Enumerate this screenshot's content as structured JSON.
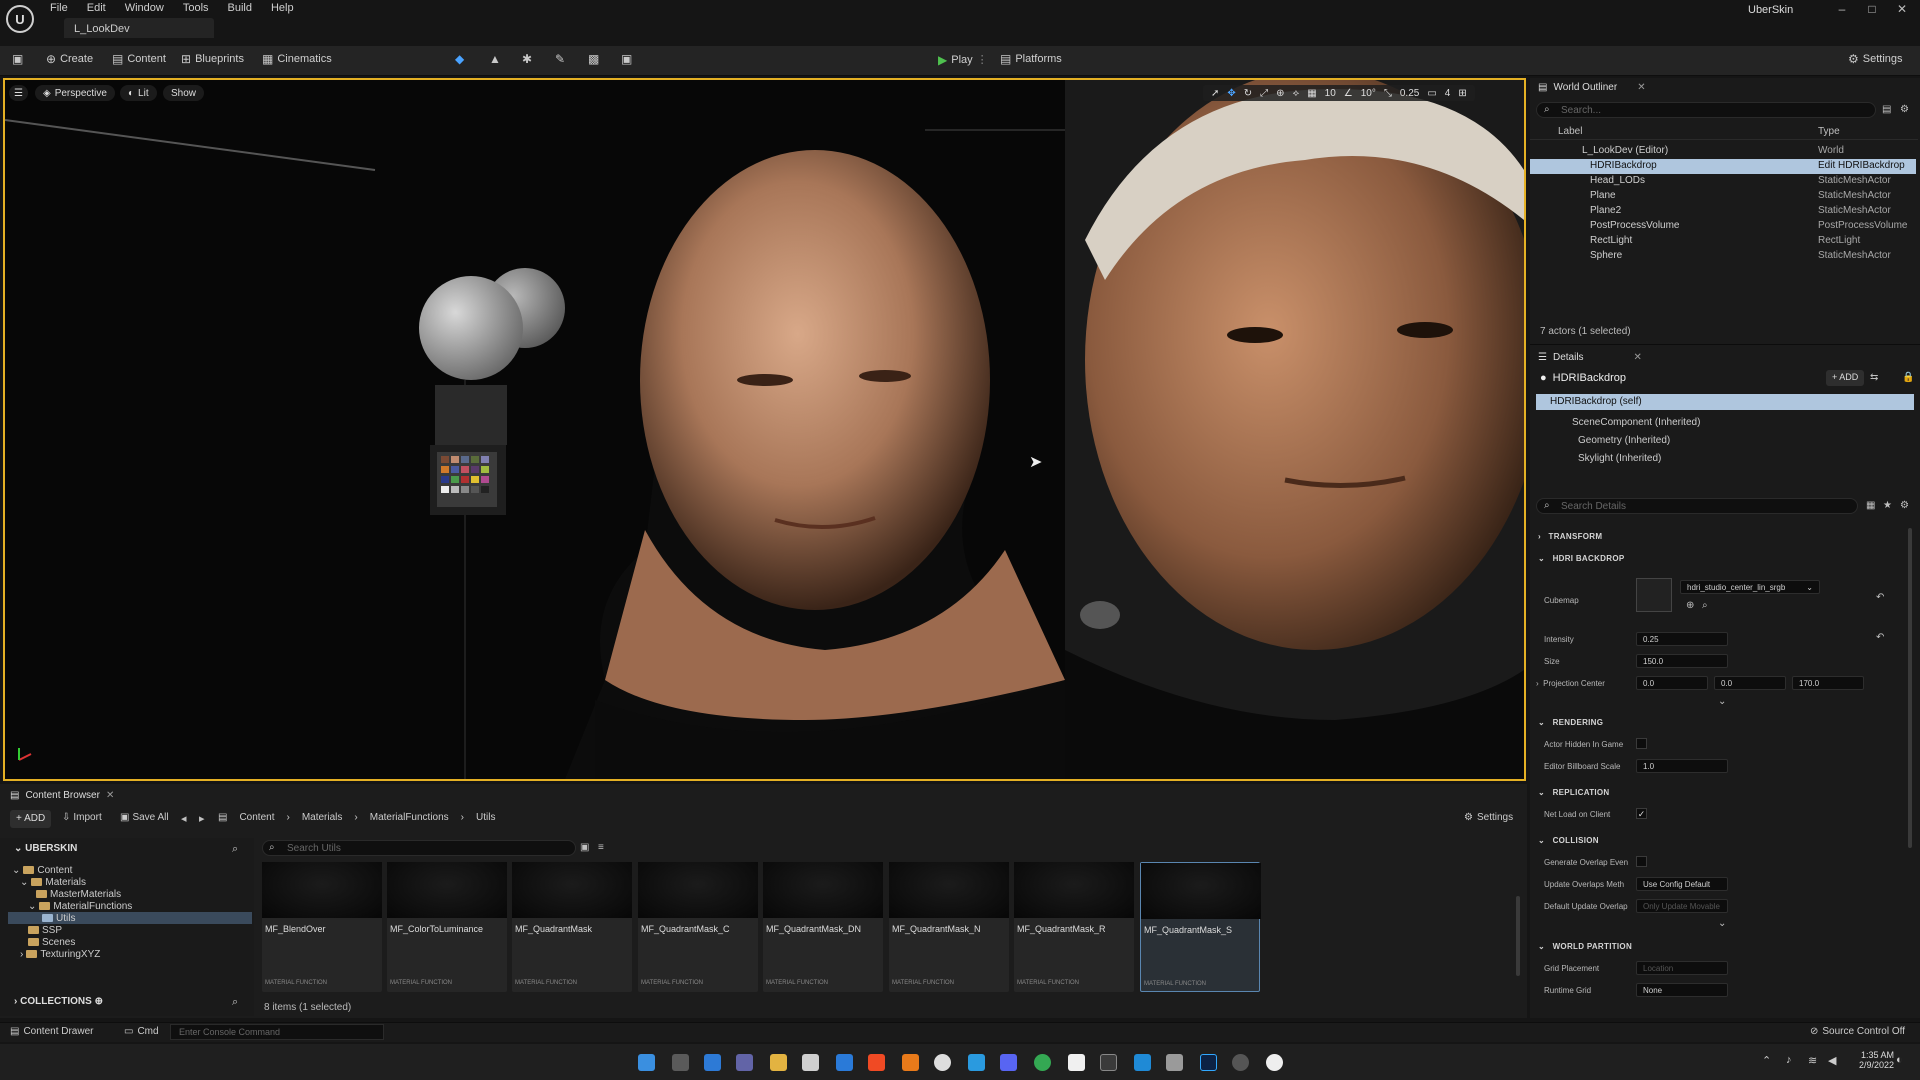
{
  "app": {
    "project": "UberSkin",
    "level_tab": "L_LookDev",
    "menu": [
      "File",
      "Edit",
      "Window",
      "Tools",
      "Build",
      "Help"
    ],
    "win": {
      "min": "–",
      "max": "□",
      "close": "✕"
    }
  },
  "toolbar": {
    "create": "Create",
    "content": "Content",
    "blueprints": "Blueprints",
    "cinematics": "Cinematics",
    "play": "Play",
    "platforms": "Platforms",
    "settings": "Settings"
  },
  "viewport": {
    "perspective": "Perspective",
    "lit": "Lit",
    "show": "Show",
    "grid": "10",
    "angle": "10°",
    "scale": "0.25",
    "camera": "4"
  },
  "outliner": {
    "title": "World Outliner",
    "search": "Search...",
    "col_label": "Label",
    "col_type": "Type",
    "rows": [
      {
        "label": "L_LookDev (Editor)",
        "type": "World"
      },
      {
        "label": "HDRIBackdrop",
        "type": "Edit HDRIBackdrop"
      },
      {
        "label": "Head_LODs",
        "type": "StaticMeshActor"
      },
      {
        "label": "Plane",
        "type": "StaticMeshActor"
      },
      {
        "label": "Plane2",
        "type": "StaticMeshActor"
      },
      {
        "label": "PostProcessVolume",
        "type": "PostProcessVolume"
      },
      {
        "label": "RectLight",
        "type": "RectLight"
      },
      {
        "label": "Sphere",
        "type": "StaticMeshActor"
      }
    ],
    "status": "7 actors (1 selected)"
  },
  "details": {
    "title": "Details",
    "actor": "HDRIBackdrop",
    "add": "ADD",
    "self": "HDRIBackdrop (self)",
    "components": [
      "SceneComponent (Inherited)",
      "Geometry (Inherited)",
      "Skylight (Inherited)"
    ],
    "search": "Search Details",
    "sections": {
      "transform": "TRANSFORM",
      "hdri": "HDRI BACKDROP",
      "rendering": "RENDERING",
      "replication": "REPLICATION",
      "collision": "COLLISION",
      "world_partition": "WORLD PARTITION"
    },
    "cubemap_label": "Cubemap",
    "cubemap_value": "hdri_studio_center_lin_srgb",
    "intensity_label": "Intensity",
    "intensity": "0.25",
    "size_label": "Size",
    "size": "150.0",
    "proj_label": "Projection Center",
    "proj_x": "0.0",
    "proj_y": "0.0",
    "proj_z": "170.0",
    "hidden_label": "Actor Hidden In Game",
    "billboard_label": "Editor Billboard Scale",
    "billboard": "1.0",
    "netload_label": "Net Load on Client",
    "genoverlap_label": "Generate Overlap Even",
    "updoverlap_label": "Update Overlaps Meth",
    "updoverlap_value": "Use Config Default",
    "defupdate_label": "Default Update Overlap",
    "defupdate_value": "Only Update Movable",
    "grid_label": "Grid Placement",
    "grid_value": "Location",
    "runtime_label": "Runtime Grid",
    "runtime_value": "None"
  },
  "content_browser": {
    "tab": "Content Browser",
    "add": "ADD",
    "import": "Import",
    "save_all": "Save All",
    "settings": "Settings",
    "path": [
      "Content",
      "Materials",
      "MaterialFunctions",
      "Utils"
    ],
    "root": "UBERSKIN",
    "search": "Search Utils",
    "tree": [
      "Content",
      "Materials",
      "MasterMaterials",
      "MaterialFunctions",
      "Utils",
      "SSP",
      "Scenes",
      "TexturingXYZ"
    ],
    "collections": "COLLECTIONS",
    "items": [
      "MF_BlendOver",
      "MF_ColorToLuminance",
      "MF_QuadrantMask",
      "MF_QuadrantMask_C",
      "MF_QuadrantMask_DN",
      "MF_QuadrantMask_N",
      "MF_QuadrantMask_R",
      "MF_QuadrantMask_S"
    ],
    "kind": "MATERIAL FUNCTION",
    "status": "8 items (1 selected)"
  },
  "status": {
    "drawer": "Content Drawer",
    "cmd": "Cmd",
    "console": "Enter Console Command",
    "source": "Source Control Off"
  },
  "clock": {
    "time": "1:35 AM",
    "date": "2/9/2022"
  }
}
